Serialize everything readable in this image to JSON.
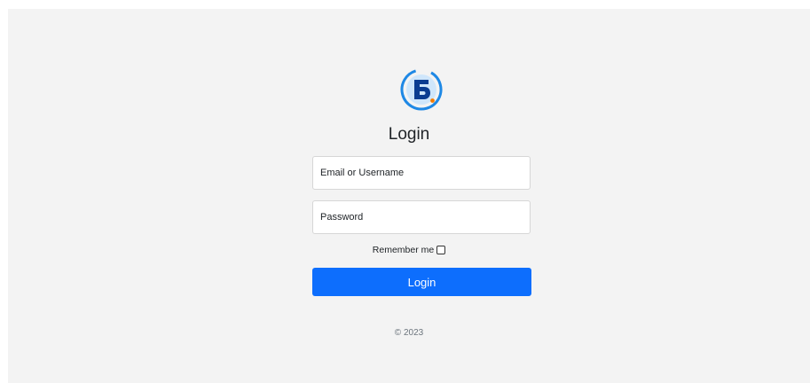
{
  "logo": {
    "icon": "b-logo-icon",
    "letter": "Б"
  },
  "title": "Login",
  "form": {
    "email_placeholder": "Email or Username",
    "password_placeholder": "Password",
    "remember_label": "Remember me",
    "login_button": "Login"
  },
  "footer": {
    "copyright": "© 2023"
  },
  "colors": {
    "background": "#f3f3f3",
    "primary": "#0d6efd",
    "logo_blue": "#1e88e5",
    "logo_dark": "#0b3d91",
    "logo_accent": "#f57c00"
  }
}
